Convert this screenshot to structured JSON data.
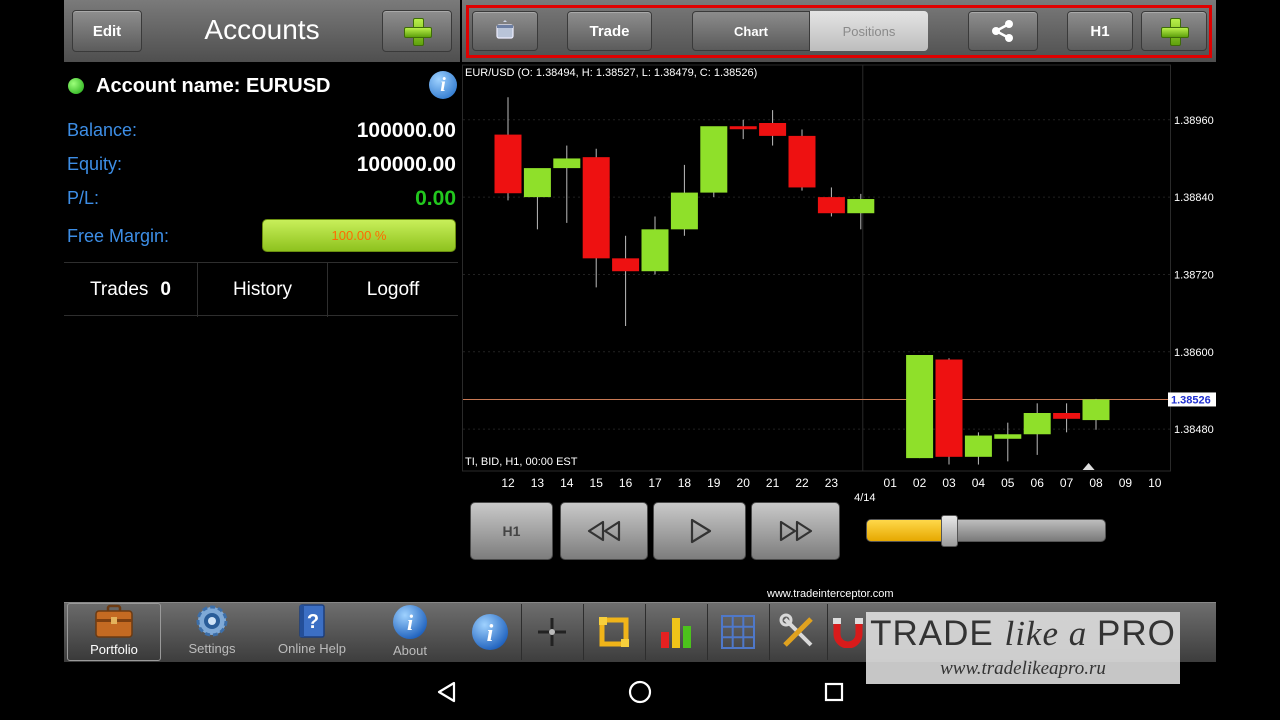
{
  "left_header": {
    "edit_label": "Edit",
    "title": "Accounts"
  },
  "toolbar": {
    "trade_label": "Trade",
    "chart_label": "Chart",
    "positions_label": "Positions",
    "timeframe_label": "H1",
    "highlight_color": "#e00000"
  },
  "account": {
    "name": "Account name: EURUSD",
    "status_color": "#1aa510",
    "balance_label": "Balance:",
    "balance_value": "100000.00",
    "equity_label": "Equity:",
    "equity_value": "100000.00",
    "pl_label": "P/L:",
    "pl_value": "0.00",
    "pl_color": "#22c81e",
    "free_margin_label": "Free Margin:",
    "free_margin_value": "100.00 %"
  },
  "account_tabs": {
    "trades_label": "Trades",
    "trades_count": "0",
    "history_label": "History",
    "logoff_label": "Logoff"
  },
  "chart_data": {
    "type": "candlestick",
    "title": "EUR/USD (O: 1.38494, H: 1.38527, L: 1.38479, C: 1.38526)",
    "footer": "TI, BID, H1, 00:00 EST",
    "ylim": [
      1.38415,
      1.39045
    ],
    "y_ticks": [
      "1.38960",
      "1.38840",
      "1.38720",
      "1.38600",
      "1.38480"
    ],
    "y_tick_values": [
      1.3896,
      1.3884,
      1.3872,
      1.386,
      1.3848
    ],
    "current_price": "1.38526",
    "current_price_value": 1.38526,
    "x_ticks": [
      "12",
      "13",
      "14",
      "15",
      "16",
      "17",
      "18",
      "19",
      "20",
      "21",
      "22",
      "23",
      "",
      "01",
      "02",
      "03",
      "04",
      "05",
      "06",
      "07",
      "08",
      "09",
      "10"
    ],
    "date_label": "4/14",
    "date_label_after_index": 11,
    "up_color": "#8fe02a",
    "down_color": "#ee1111",
    "candles": [
      {
        "x": 0,
        "o": 1.38937,
        "h": 1.38995,
        "l": 1.38835,
        "c": 1.38846
      },
      {
        "x": 1,
        "o": 1.3884,
        "h": 1.3886,
        "l": 1.3879,
        "c": 1.38885
      },
      {
        "x": 2,
        "o": 1.38885,
        "h": 1.3892,
        "l": 1.388,
        "c": 1.389
      },
      {
        "x": 3,
        "o": 1.38902,
        "h": 1.38915,
        "l": 1.387,
        "c": 1.38745
      },
      {
        "x": 4,
        "o": 1.38745,
        "h": 1.3878,
        "l": 1.3864,
        "c": 1.38725
      },
      {
        "x": 5,
        "o": 1.38725,
        "h": 1.3881,
        "l": 1.3872,
        "c": 1.3879
      },
      {
        "x": 6,
        "o": 1.3879,
        "h": 1.3889,
        "l": 1.3878,
        "c": 1.38847
      },
      {
        "x": 7,
        "o": 1.38847,
        "h": 1.38935,
        "l": 1.3884,
        "c": 1.3895
      },
      {
        "x": 8,
        "o": 1.3895,
        "h": 1.3896,
        "l": 1.3893,
        "c": 1.38947
      },
      {
        "x": 9,
        "o": 1.38955,
        "h": 1.38975,
        "l": 1.3892,
        "c": 1.38935
      },
      {
        "x": 10,
        "o": 1.38935,
        "h": 1.38945,
        "l": 1.3885,
        "c": 1.38855
      },
      {
        "x": 11,
        "o": 1.3884,
        "h": 1.38855,
        "l": 1.3881,
        "c": 1.38815
      },
      {
        "x": 12,
        "o": 1.38815,
        "h": 1.38845,
        "l": 1.3879,
        "c": 1.38837
      },
      {
        "x": 14,
        "o": 1.38435,
        "h": 1.38595,
        "l": 1.38435,
        "c": 1.38595
      },
      {
        "x": 15,
        "o": 1.38588,
        "h": 1.3859,
        "l": 1.38425,
        "c": 1.38437
      },
      {
        "x": 16,
        "o": 1.38437,
        "h": 1.38475,
        "l": 1.38425,
        "c": 1.3847
      },
      {
        "x": 17,
        "o": 1.38465,
        "h": 1.3849,
        "l": 1.3843,
        "c": 1.38472
      },
      {
        "x": 18,
        "o": 1.38472,
        "h": 1.3852,
        "l": 1.3844,
        "c": 1.38505
      },
      {
        "x": 19,
        "o": 1.38505,
        "h": 1.3852,
        "l": 1.38475,
        "c": 1.38496
      },
      {
        "x": 20,
        "o": 1.38494,
        "h": 1.38527,
        "l": 1.38479,
        "c": 1.38526
      }
    ]
  },
  "playback": {
    "timeframe_label": "H1",
    "slider_fraction": 0.35,
    "slider_color": "#f2c21a"
  },
  "url_text": "www.tradeinterceptor.com",
  "dock": {
    "portfolio_label": "Portfolio",
    "settings_label": "Settings",
    "help_label": "Online Help",
    "about_label": "About"
  },
  "watermark": {
    "brand_part1": "TRADE ",
    "brand_part2": "like a ",
    "brand_part3": "PRO",
    "url": "www.tradelikeapro.ru"
  }
}
